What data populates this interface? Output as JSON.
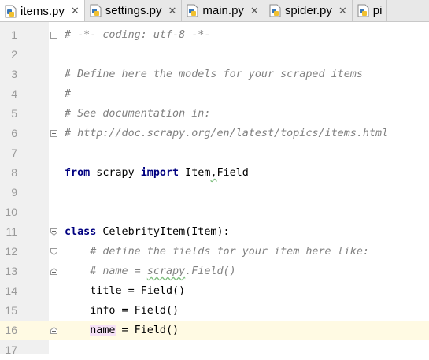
{
  "tabs": [
    {
      "label": "items.py",
      "active": true
    },
    {
      "label": "settings.py",
      "active": false
    },
    {
      "label": "main.py",
      "active": false
    },
    {
      "label": "spider.py",
      "active": false
    },
    {
      "label": "pi",
      "active": false
    }
  ],
  "close_glyph": "✕",
  "current_line": 16,
  "line_numbers": [
    "1",
    "2",
    "3",
    "4",
    "5",
    "6",
    "7",
    "8",
    "9",
    "10",
    "11",
    "12",
    "13",
    "14",
    "15",
    "16",
    "17"
  ],
  "code": {
    "l1": "# -*- coding: utf-8 -*-",
    "l3": "# Define here the models for your scraped items",
    "l4": "#",
    "l5": "# See documentation in:",
    "l6": "# http://doc.scrapy.org/en/latest/topics/items.html",
    "l8_kw1": "from",
    "l8_mod": " scrapy ",
    "l8_kw2": "import",
    "l8_items": " Item",
    "l8_comma": ",",
    "l8_field": "Field",
    "l11_kw": "class",
    "l11_rest": " CelebrityItem(Item):",
    "l12": "    # define the fields for your item here like:",
    "l13_a": "    # name = ",
    "l13_b": "scrapy",
    "l13_c": ".Field()",
    "l14": "    title = Field()",
    "l15": "    info = Field()",
    "l16_indent": "    ",
    "l16_name": "name",
    "l16_rest": " = Field()"
  },
  "colors": {
    "comment": "#808080",
    "keyword": "#000080",
    "current_line_bg": "#fffae3",
    "gutter_bg": "#f0f0f0"
  }
}
